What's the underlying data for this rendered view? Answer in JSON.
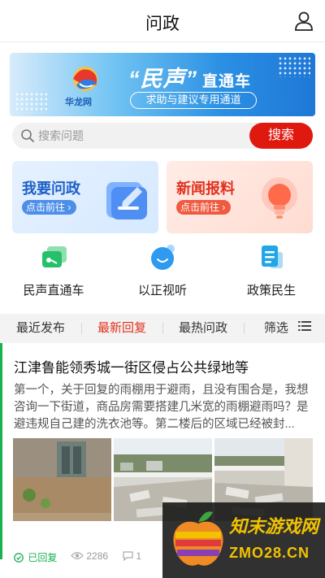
{
  "header": {
    "title": "问政",
    "user_icon": "user-icon"
  },
  "banner": {
    "logo_text": "华龙网",
    "headline_quoted": "“民声”",
    "headline_tail": "直通车",
    "subtitle": "求助与建议专用通道"
  },
  "search": {
    "placeholder": "搜索问题",
    "button_label": "搜索"
  },
  "cards": [
    {
      "title": "我要问政",
      "go_label": "点击前往",
      "icon": "edit-icon"
    },
    {
      "title": "新闻报料",
      "go_label": "点击前往",
      "icon": "bulb-icon"
    }
  ],
  "shortcuts": [
    {
      "label": "民声直通车",
      "icon": "chat-icon"
    },
    {
      "label": "以正视听",
      "icon": "smile-bubble-icon"
    },
    {
      "label": "政策民生",
      "icon": "document-icon"
    }
  ],
  "tabs": [
    {
      "label": "最近发布",
      "active": false
    },
    {
      "label": "最新回复",
      "active": true
    },
    {
      "label": "最热问政",
      "active": false
    },
    {
      "label": "筛选",
      "active": false
    }
  ],
  "article": {
    "title": "江津鲁能领秀城一街区侵占公共绿地等",
    "body": "第一个，关于回复的雨棚用于避雨，且没有围合是，我想咨询一下街道，商品房需要搭建几米宽的雨棚避雨吗？是避违规自己建的洗衣池等。第二楼后的区域已经被封...",
    "status": "已回复",
    "views": "2286",
    "comments": "1"
  },
  "watermark": {
    "name": "知末游戏网",
    "url": "ZMO28.CN"
  },
  "colors": {
    "accent_red": "#e0190f",
    "accent_green": "#18b251",
    "card_blue": "#1c5fc8"
  }
}
